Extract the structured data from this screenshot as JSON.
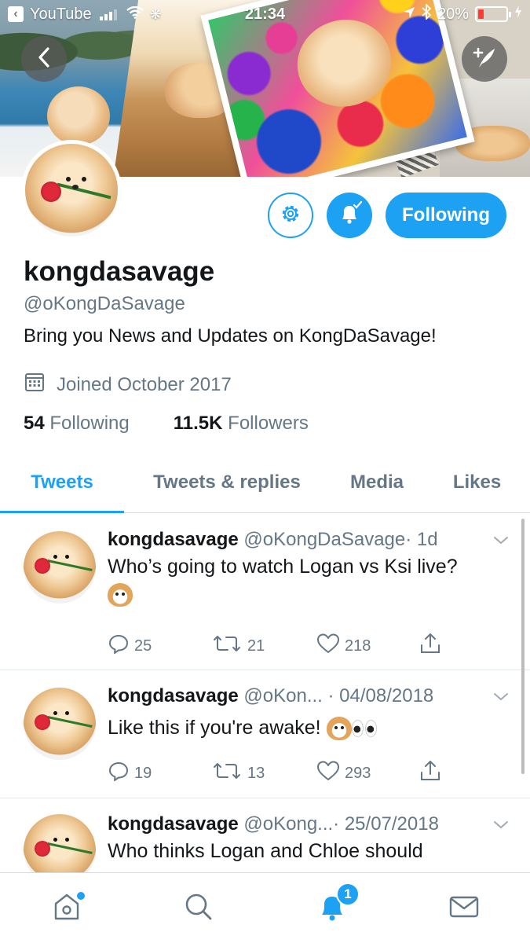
{
  "status_bar": {
    "back_app": "YouTube",
    "time": "21:34",
    "battery": "20%",
    "battery_level": 0.2
  },
  "profile": {
    "display_name": "kongdasavage",
    "handle": "@oKongDaSavage",
    "bio": "Bring you News and Updates on KongDaSavage!",
    "joined": "Joined October 2017",
    "following_count": "54",
    "following_label": "Following",
    "followers_count": "11.5K",
    "followers_label": "Followers",
    "follow_button": "Following"
  },
  "tabs": [
    {
      "label": "Tweets",
      "active": true
    },
    {
      "label": "Tweets & replies",
      "active": false
    },
    {
      "label": "Media",
      "active": false
    },
    {
      "label": "Likes",
      "active": false
    }
  ],
  "tweets": [
    {
      "name": "kongdasavage",
      "handle": "@oKongDaSavage",
      "time": "· 1d",
      "text": "Who’s going to watch Logan vs Ksi live?",
      "replies": "25",
      "retweets": "21",
      "likes": "218"
    },
    {
      "name": "kongdasavage",
      "handle": "@oKon...",
      "time": "· 04/08/2018",
      "text": "Like this if you're awake!",
      "replies": "19",
      "retweets": "13",
      "likes": "293"
    },
    {
      "name": "kongdasavage",
      "handle": "@oKong...",
      "time": "· 25/07/2018",
      "text": "Who thinks Logan and Chloe should"
    }
  ],
  "bottom_nav": {
    "notification_count": "1"
  },
  "icons": {
    "back": "chevron-left-icon",
    "compose": "compose-tweet-icon",
    "settings": "gear-icon",
    "notifications_on": "bell-check-icon",
    "calendar": "calendar-icon",
    "reply": "reply-icon",
    "retweet": "retweet-icon",
    "like": "heart-icon",
    "share": "share-icon",
    "home": "home-icon",
    "search": "search-icon",
    "notifications": "bell-icon",
    "messages": "envelope-icon"
  },
  "colors": {
    "accent": "#1da1f2",
    "secondary_text": "#657786",
    "primary_text": "#14171a"
  }
}
